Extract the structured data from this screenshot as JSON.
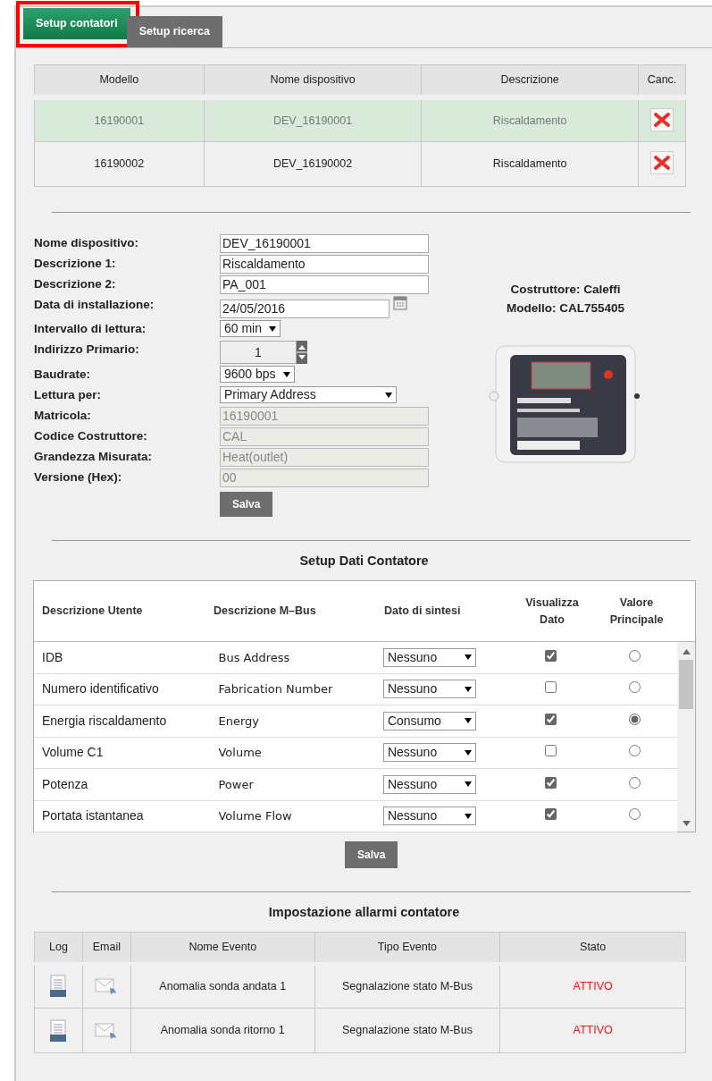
{
  "tabs": [
    {
      "label": "Setup contatori",
      "selected": true,
      "highlighted": true
    },
    {
      "label": "Setup ricerca",
      "selected": false,
      "highlighted": false
    }
  ],
  "devices": {
    "columns": [
      "Modello",
      "Nome dispositivo",
      "Descrizione",
      "Canc."
    ],
    "rows": [
      {
        "cells": [
          "16190001",
          "DEV_16190001",
          "Riscaldamento"
        ],
        "selected": true
      },
      {
        "cells": [
          "16190002",
          "DEV_16190002",
          "Riscaldamento"
        ],
        "selected": false
      }
    ]
  },
  "form": {
    "fields": [
      {
        "label": "Nome dispositivo:",
        "kind": "text",
        "value": "DEV_16190001",
        "readonly": false
      },
      {
        "label": "Descrizione 1:",
        "kind": "text",
        "value": "Riscaldamento",
        "readonly": false
      },
      {
        "label": "Descrizione 2:",
        "kind": "text",
        "value": "PA_001",
        "readonly": false
      },
      {
        "label": "Data di installazione:",
        "kind": "date",
        "value": "24/05/2016"
      },
      {
        "label": "Intervallo di lettura:",
        "kind": "select",
        "value": "60 min"
      },
      {
        "label": "Indirizzo Primario:",
        "kind": "number",
        "value": "1"
      },
      {
        "label": "Baudrate:",
        "kind": "select",
        "value": "9600 bps"
      },
      {
        "label": "Lettura per:",
        "kind": "selectwide",
        "value": "Primary Address"
      },
      {
        "label": "Matricola:",
        "kind": "text",
        "value": "16190001",
        "readonly": true
      },
      {
        "label": "Codice Costruttore:",
        "kind": "text",
        "value": "CAL",
        "readonly": true
      },
      {
        "label": "Grandezza Misurata:",
        "kind": "text",
        "value": "Heat(outlet)",
        "readonly": true
      },
      {
        "label": "Versione (Hex):",
        "kind": "text",
        "value": "00",
        "readonly": true
      }
    ],
    "save": "Salva",
    "manufacturer": "Costruttore: Caleffi",
    "model": "Modello: CAL755405"
  },
  "data_setup": {
    "title": "Setup Dati Contatore",
    "columns": [
      "Descrizione Utente",
      "Descrizione M–Bus",
      "Dato di sintesi",
      "Visualizza Dato",
      "Valore Principale"
    ],
    "rows": [
      {
        "user": "IDB",
        "mbus": "Bus Address",
        "summary": "Nessuno",
        "show": true,
        "main": false
      },
      {
        "user": "Numero identificativo",
        "mbus": "Fabrication Number",
        "summary": "Nessuno",
        "show": false,
        "main": false
      },
      {
        "user": "Energia riscaldamento",
        "mbus": "Energy",
        "summary": "Consumo",
        "show": true,
        "main": true
      },
      {
        "user": "Volume C1",
        "mbus": "Volume",
        "summary": "Nessuno",
        "show": false,
        "main": false
      },
      {
        "user": "Potenza",
        "mbus": "Power",
        "summary": "Nessuno",
        "show": true,
        "main": false
      },
      {
        "user": "Portata istantanea",
        "mbus": "Volume Flow",
        "summary": "Nessuno",
        "show": true,
        "main": false
      }
    ],
    "save": "Salva"
  },
  "alarms": {
    "title": "Impostazione allarmi contatore",
    "columns": [
      "Log",
      "Email",
      "Nome Evento",
      "Tipo Evento",
      "Stato"
    ],
    "rows": [
      {
        "name": "Anomalia sonda andata 1",
        "type": "Segnalazione stato M-Bus",
        "status": "ATTIVO"
      },
      {
        "name": "Anomalia sonda ritorno 1",
        "type": "Segnalazione stato M-Bus",
        "status": "ATTIVO"
      }
    ]
  }
}
